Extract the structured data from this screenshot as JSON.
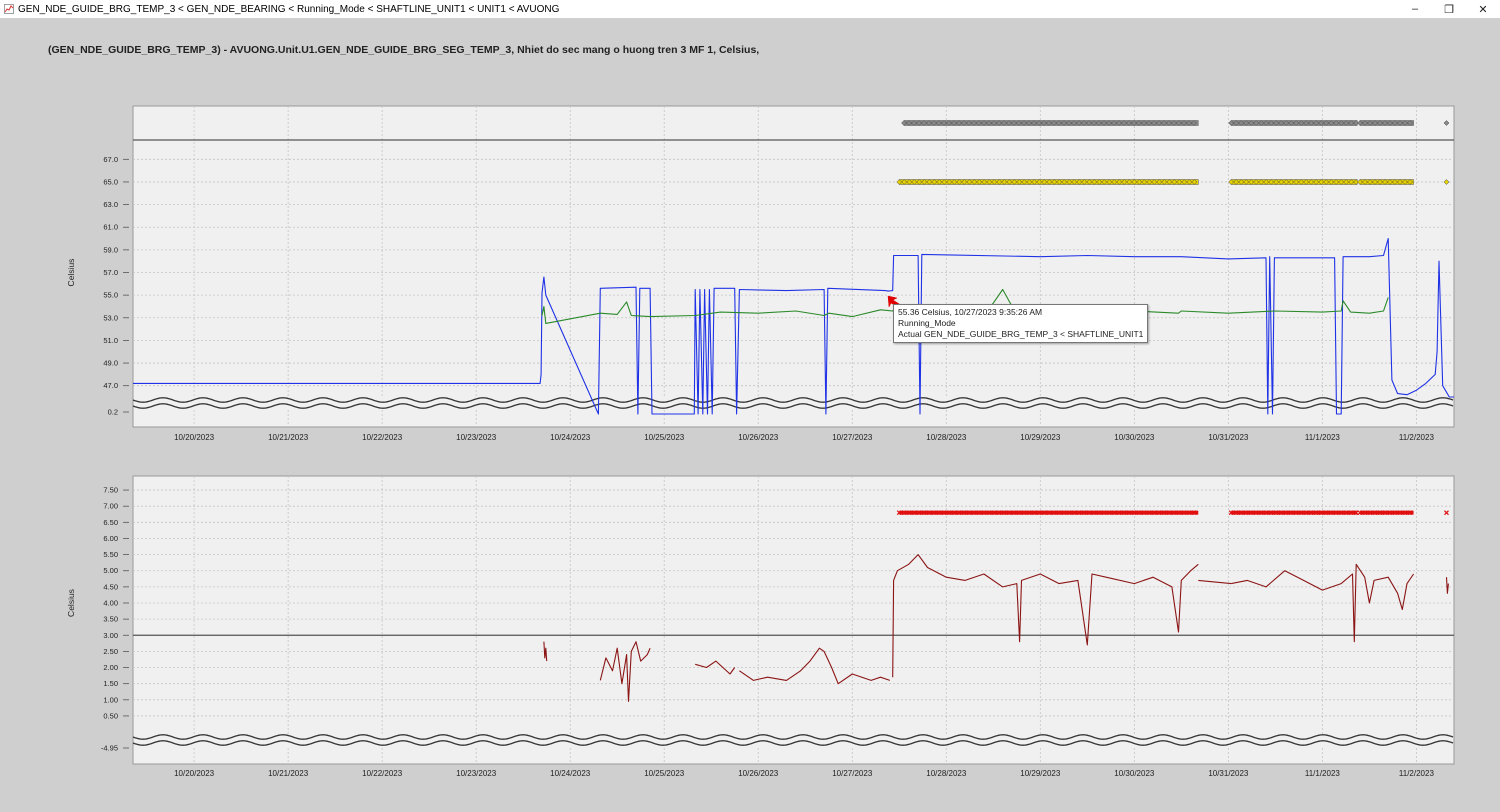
{
  "window": {
    "title": "GEN_NDE_GUIDE_BRG_TEMP_3 < GEN_NDE_BEARING < Running_Mode < SHAFTLINE_UNIT1 < UNIT1 < AVUONG",
    "minimize_label": "–",
    "maximize_label": "❐",
    "close_label": "✕"
  },
  "heading": "(GEN_NDE_GUIDE_BRG_TEMP_3) - AVUONG.Unit.U1.GEN_NDE_GUIDE_BRG_SEG_TEMP_3, Nhiet do sec mang o huong tren 3 MF 1, Celsius,",
  "tooltip": {
    "line1": "55.36 Celsius, 10/27/2023 9:35:26 AM",
    "line2": "Running_Mode",
    "line3": "Actual GEN_NDE_GUIDE_BRG_TEMP_3 < SHAFTLINE_UNIT1"
  },
  "colors": {
    "actual": "#1f32e6",
    "secondary": "#2a8a2a",
    "lower": "#8b1414",
    "marker_gray": "#8a8a8a",
    "marker_yellow": "#e6d200",
    "marker_red": "#e01010",
    "arrow": "#e00000"
  },
  "chart_data": [
    {
      "type": "line",
      "ylabel": "Celsius",
      "x_tick_labels": [
        "10/20/2023",
        "10/21/2023",
        "10/22/2023",
        "10/23/2023",
        "10/24/2023",
        "10/25/2023",
        "10/26/2023",
        "10/27/2023",
        "10/28/2023",
        "10/29/2023",
        "10/30/2023",
        "10/31/2023",
        "11/1/2023",
        "11/2/2023"
      ],
      "xlim": [
        -0.65,
        13.4
      ],
      "ylim": [
        46.0,
        68.0
      ],
      "y_tick_labels": [
        "67.0",
        "65.0",
        "63.0",
        "61.0",
        "59.0",
        "57.0",
        "55.0",
        "53.0",
        "51.0",
        "49.0",
        "47.0"
      ],
      "y_ticks": [
        67,
        65,
        63,
        61,
        59,
        57,
        55,
        53,
        51,
        49,
        47
      ],
      "broken_axis_label": "0.2",
      "grid": true,
      "series": [
        {
          "name": "Actual GEN_NDE_GUIDE_BRG_TEMP_3 < SHAFTLINE_UNIT1",
          "points": [
            [
              -0.65,
              47.2
            ],
            [
              3.68,
              47.2
            ],
            [
              3.69,
              48.0
            ],
            [
              3.7,
              55.2
            ],
            [
              3.72,
              56.6
            ],
            [
              3.74,
              55.0
            ],
            [
              4.3,
              44.5
            ],
            [
              4.32,
              55.6
            ],
            [
              4.7,
              55.7
            ],
            [
              4.72,
              44.5
            ],
            [
              4.74,
              55.6
            ],
            [
              4.85,
              55.6
            ],
            [
              4.87,
              44.5
            ],
            [
              5.32,
              44.5
            ],
            [
              5.33,
              55.5
            ],
            [
              5.36,
              44.5
            ],
            [
              5.38,
              55.5
            ],
            [
              5.41,
              44.5
            ],
            [
              5.43,
              55.5
            ],
            [
              5.46,
              44.5
            ],
            [
              5.48,
              55.5
            ],
            [
              5.51,
              44.5
            ],
            [
              5.53,
              55.6
            ],
            [
              5.75,
              55.6
            ],
            [
              5.77,
              44.5
            ],
            [
              5.8,
              55.5
            ],
            [
              6.3,
              55.4
            ],
            [
              6.7,
              55.5
            ],
            [
              6.72,
              44.5
            ],
            [
              6.74,
              55.6
            ],
            [
              7.35,
              55.4
            ],
            [
              7.38,
              55.36
            ],
            [
              7.43,
              55.4
            ],
            [
              7.44,
              58.5
            ],
            [
              7.7,
              58.5
            ],
            [
              7.72,
              44.5
            ],
            [
              7.74,
              58.6
            ],
            [
              9.0,
              58.4
            ],
            [
              9.5,
              58.5
            ],
            [
              10.0,
              58.4
            ],
            [
              10.5,
              58.4
            ],
            [
              11.0,
              58.2
            ],
            [
              11.4,
              58.3
            ],
            [
              11.42,
              44.5
            ],
            [
              11.44,
              58.4
            ],
            [
              11.47,
              44.5
            ],
            [
              11.49,
              58.3
            ],
            [
              12.13,
              58.3
            ],
            [
              12.15,
              44.5
            ],
            [
              12.2,
              44.5
            ],
            [
              12.22,
              58.4
            ],
            [
              12.5,
              58.4
            ],
            [
              12.65,
              58.5
            ],
            [
              12.7,
              60.0
            ],
            [
              12.74,
              47.5
            ],
            [
              12.8,
              46.3
            ],
            [
              12.9,
              46.2
            ],
            [
              13.0,
              46.6
            ],
            [
              13.1,
              47.2
            ],
            [
              13.2,
              48.0
            ],
            [
              13.22,
              50.0
            ],
            [
              13.24,
              58.0
            ],
            [
              13.28,
              47.0
            ],
            [
              13.35,
              46.0
            ],
            [
              13.4,
              46.0
            ]
          ]
        },
        {
          "name": "",
          "points": [
            [
              3.7,
              53.2
            ],
            [
              3.72,
              54.0
            ],
            [
              3.74,
              52.5
            ],
            [
              4.32,
              53.4
            ],
            [
              4.5,
              53.3
            ],
            [
              4.6,
              54.4
            ],
            [
              4.65,
              53.2
            ],
            [
              4.85,
              53.1
            ],
            [
              5.33,
              53.2
            ],
            [
              5.6,
              53.5
            ],
            [
              6.0,
              53.4
            ],
            [
              6.4,
              53.6
            ],
            [
              6.7,
              53.2
            ],
            [
              6.75,
              53.4
            ],
            [
              7.0,
              53.1
            ],
            [
              7.3,
              53.7
            ],
            [
              7.43,
              53.6
            ],
            [
              7.44,
              53.7
            ],
            [
              7.8,
              53.4
            ],
            [
              8.2,
              53.6
            ],
            [
              8.4,
              53.3
            ],
            [
              8.5,
              54.3
            ],
            [
              8.6,
              55.5
            ],
            [
              8.7,
              54.0
            ],
            [
              9.0,
              53.6
            ],
            [
              9.5,
              53.4
            ],
            [
              10.0,
              53.6
            ],
            [
              10.47,
              53.4
            ],
            [
              10.5,
              53.6
            ],
            [
              11.0,
              53.4
            ],
            [
              11.5,
              53.6
            ],
            [
              12.0,
              53.5
            ],
            [
              12.2,
              53.6
            ],
            [
              12.22,
              54.5
            ],
            [
              12.3,
              53.5
            ],
            [
              12.5,
              53.4
            ],
            [
              12.65,
              53.6
            ],
            [
              12.7,
              54.8
            ]
          ]
        }
      ],
      "marker_rows": [
        {
          "shape": "diamond",
          "color": "gray",
          "spans": [
            [
              7.55,
              10.68
            ],
            [
              11.03,
              12.37
            ],
            [
              12.4,
              12.97
            ]
          ],
          "single": 13.32
        },
        {
          "shape": "diamond",
          "color": "yellow",
          "spans": [
            [
              7.5,
              10.68
            ],
            [
              11.03,
              12.37
            ],
            [
              12.4,
              12.97
            ]
          ],
          "single": 13.32
        }
      ]
    },
    {
      "type": "line",
      "ylabel": "Celsius",
      "x_tick_labels": [
        "10/20/2023",
        "10/21/2023",
        "10/22/2023",
        "10/23/2023",
        "10/24/2023",
        "10/25/2023",
        "10/26/2023",
        "10/27/2023",
        "10/28/2023",
        "10/29/2023",
        "10/30/2023",
        "10/31/2023",
        "11/1/2023",
        "11/2/2023"
      ],
      "xlim": [
        -0.65,
        13.4
      ],
      "ylim": [
        0.25,
        7.75
      ],
      "y_tick_labels": [
        "7.50",
        "7.00",
        "6.50",
        "6.00",
        "5.50",
        "5.00",
        "4.50",
        "4.00",
        "3.50",
        "3.00",
        "2.50",
        "2.00",
        "1.50",
        "1.00",
        "0.50"
      ],
      "y_ticks": [
        7.5,
        7.0,
        6.5,
        6.0,
        5.5,
        5.0,
        4.5,
        4.0,
        3.5,
        3.0,
        2.5,
        2.0,
        1.5,
        1.0,
        0.5
      ],
      "broken_axis_label": "-4.95",
      "threshold": 3.0,
      "grid": true,
      "series": [
        {
          "name": "",
          "segments": [
            [
              [
                3.72,
                2.8
              ],
              [
                3.73,
                2.3
              ],
              [
                3.74,
                2.6
              ],
              [
                3.75,
                2.2
              ]
            ],
            [
              [
                4.32,
                1.6
              ],
              [
                4.38,
                2.3
              ],
              [
                4.45,
                1.9
              ],
              [
                4.5,
                2.6
              ],
              [
                4.55,
                1.5
              ],
              [
                4.6,
                2.4
              ],
              [
                4.62,
                0.95
              ],
              [
                4.65,
                2.5
              ],
              [
                4.7,
                2.8
              ],
              [
                4.75,
                2.2
              ],
              [
                4.82,
                2.4
              ],
              [
                4.85,
                2.6
              ]
            ],
            [
              [
                5.33,
                2.1
              ],
              [
                5.45,
                2.0
              ],
              [
                5.55,
                2.2
              ],
              [
                5.7,
                1.8
              ],
              [
                5.75,
                2.0
              ]
            ],
            [
              [
                5.8,
                1.9
              ],
              [
                5.95,
                1.6
              ],
              [
                6.1,
                1.7
              ],
              [
                6.3,
                1.6
              ],
              [
                6.45,
                1.9
              ],
              [
                6.55,
                2.2
              ],
              [
                6.65,
                2.6
              ],
              [
                6.7,
                2.5
              ],
              [
                6.78,
                2.0
              ],
              [
                6.85,
                1.5
              ],
              [
                7.0,
                1.8
              ],
              [
                7.2,
                1.6
              ],
              [
                7.3,
                1.7
              ],
              [
                7.4,
                1.6
              ]
            ],
            [
              [
                7.43,
                1.7
              ],
              [
                7.44,
                4.7
              ],
              [
                7.48,
                5.0
              ],
              [
                7.6,
                5.2
              ],
              [
                7.7,
                5.5
              ],
              [
                7.8,
                5.1
              ],
              [
                8.0,
                4.8
              ],
              [
                8.2,
                4.7
              ],
              [
                8.4,
                4.9
              ],
              [
                8.6,
                4.5
              ],
              [
                8.75,
                4.6
              ],
              [
                8.78,
                2.8
              ],
              [
                8.8,
                4.7
              ],
              [
                9.0,
                4.9
              ],
              [
                9.2,
                4.6
              ],
              [
                9.4,
                4.7
              ],
              [
                9.5,
                2.7
              ],
              [
                9.55,
                4.9
              ],
              [
                9.7,
                4.8
              ],
              [
                10.0,
                4.6
              ],
              [
                10.2,
                4.8
              ],
              [
                10.4,
                4.5
              ],
              [
                10.47,
                3.1
              ],
              [
                10.5,
                4.7
              ],
              [
                10.6,
                5.0
              ],
              [
                10.68,
                5.2
              ]
            ],
            [
              [
                10.68,
                4.7
              ],
              [
                11.03,
                4.6
              ]
            ],
            [
              [
                11.03,
                4.6
              ],
              [
                11.2,
                4.7
              ],
              [
                11.4,
                4.5
              ],
              [
                11.6,
                5.0
              ],
              [
                11.8,
                4.7
              ],
              [
                12.0,
                4.4
              ],
              [
                12.2,
                4.6
              ],
              [
                12.32,
                4.9
              ],
              [
                12.34,
                2.8
              ],
              [
                12.36,
                5.2
              ],
              [
                12.45,
                4.8
              ],
              [
                12.5,
                4.0
              ],
              [
                12.55,
                4.7
              ],
              [
                12.7,
                4.8
              ],
              [
                12.8,
                4.3
              ],
              [
                12.85,
                3.8
              ],
              [
                12.9,
                4.6
              ],
              [
                12.97,
                4.9
              ]
            ],
            [
              [
                13.32,
                4.8
              ],
              [
                13.33,
                4.3
              ],
              [
                13.34,
                4.6
              ]
            ]
          ]
        }
      ],
      "marker_rows": [
        {
          "shape": "x",
          "color": "red",
          "y": 6.8,
          "spans": [
            [
              7.5,
              10.68
            ],
            [
              11.03,
              12.37
            ],
            [
              12.4,
              12.97
            ]
          ],
          "single": 13.32
        }
      ]
    }
  ]
}
